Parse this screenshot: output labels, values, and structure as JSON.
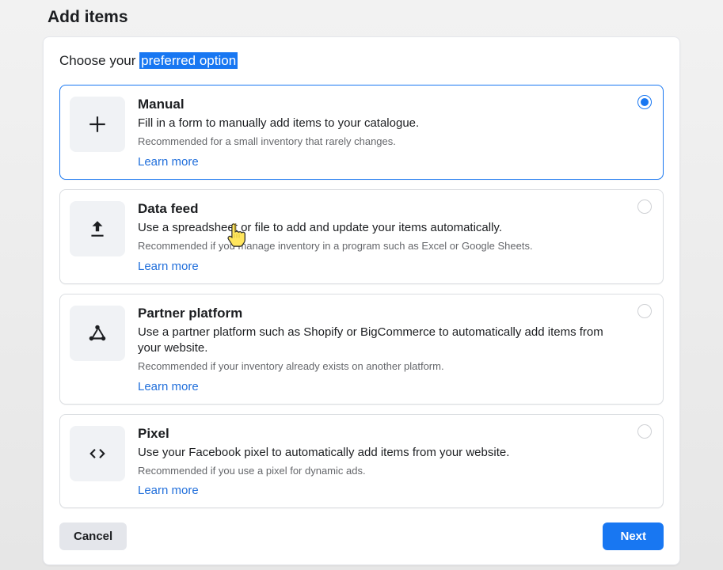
{
  "header": {
    "title": "Add items"
  },
  "choose": {
    "prefix": "Choose your ",
    "highlight": "preferred option"
  },
  "options": [
    {
      "id": "manual",
      "title": "Manual",
      "desc": "Fill in a form to manually add items to your catalogue.",
      "rec": "Recommended for a small inventory that rarely changes.",
      "learn": "Learn more",
      "selected": true
    },
    {
      "id": "data_feed",
      "title": "Data feed",
      "desc": "Use a spreadsheet or file to add and update your items automatically.",
      "rec": "Recommended if you manage inventory in a program such as Excel or Google Sheets.",
      "learn": "Learn more",
      "selected": false
    },
    {
      "id": "partner",
      "title": "Partner platform",
      "desc": "Use a partner platform such as Shopify or BigCommerce to automatically add items from your website.",
      "rec": "Recommended if your inventory already exists on another platform.",
      "learn": "Learn more",
      "selected": false
    },
    {
      "id": "pixel",
      "title": "Pixel",
      "desc": "Use your Facebook pixel to automatically add items from your website.",
      "rec": "Recommended if you use a pixel for dynamic ads.",
      "learn": "Learn more",
      "selected": false
    }
  ],
  "buttons": {
    "cancel": "Cancel",
    "next": "Next"
  }
}
